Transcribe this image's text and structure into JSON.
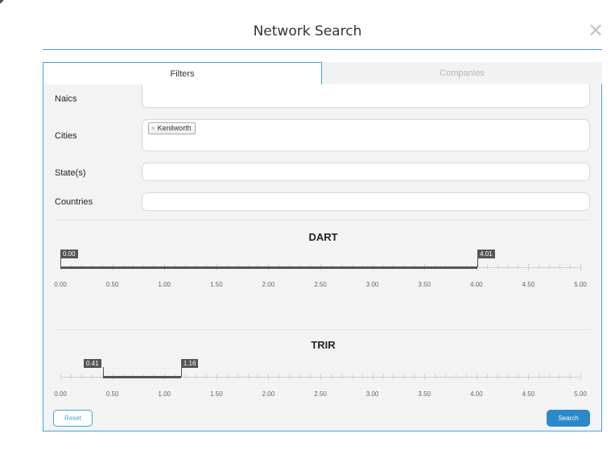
{
  "modal": {
    "title": "Network Search",
    "close_icon": "close-icon"
  },
  "tabs": [
    {
      "label": "Filters",
      "active": true
    },
    {
      "label": "Companies",
      "active": false
    }
  ],
  "fields": {
    "naics": {
      "label": "Naics",
      "value": ""
    },
    "cities": {
      "label": "Cities",
      "chips": [
        "Kenilworth"
      ],
      "chip_remove": "×"
    },
    "states": {
      "label": "State(s)",
      "value": ""
    },
    "countries": {
      "label": "Countries",
      "value": ""
    }
  },
  "sliders": [
    {
      "name": "dart",
      "title": "DART",
      "min": 0,
      "max": 5,
      "low": 0.0,
      "high": 4.01,
      "low_label": "0.00",
      "high_label": "4.01",
      "ticks": [
        "0.00",
        "0.50",
        "1.00",
        "1.50",
        "2.00",
        "2.50",
        "3.00",
        "3.50",
        "4.00",
        "4.50",
        "5.00"
      ]
    },
    {
      "name": "trir",
      "title": "TRIR",
      "min": 0,
      "max": 5,
      "low": 0.41,
      "high": 1.16,
      "low_label": "0.41",
      "high_label": "1.16",
      "ticks": [
        "0.00",
        "0.50",
        "1.00",
        "1.50",
        "2.00",
        "2.50",
        "3.00",
        "3.50",
        "4.00",
        "4.50",
        "5.00"
      ]
    }
  ],
  "buttons": {
    "reset": "Reset",
    "search": "Search"
  },
  "colors": {
    "accent": "#3fa6d8",
    "primary_button": "#2a8ac9",
    "slider_fill": "#555555"
  }
}
